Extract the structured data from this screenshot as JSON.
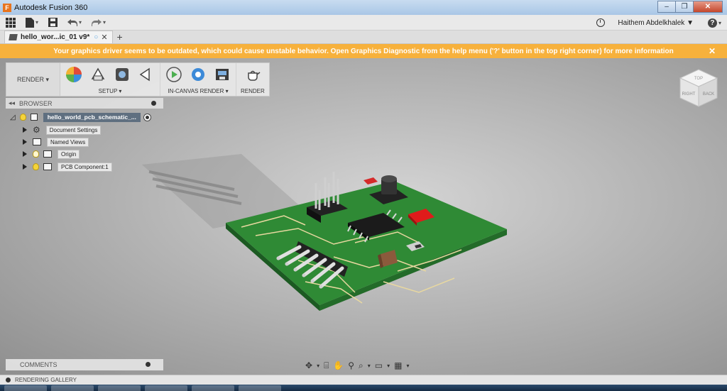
{
  "window": {
    "title": "Autodesk Fusion 360",
    "app_logo": "F",
    "controls": [
      "–",
      "❐",
      "✕"
    ]
  },
  "appbar": {
    "user": "Haithem Abdelkhalek ▼",
    "help": "?"
  },
  "tab": {
    "label": "hello_wor...ic_01 v9*",
    "close": "✕",
    "new": "+"
  },
  "banner": {
    "message": "Your graphics driver seems to be outdated, which could cause unstable behavior. Open Graphics Diagnostic from the help menu ('?' button in the top right corner) for more information",
    "close": "✕"
  },
  "toolbar": {
    "workspace": "RENDER ▾",
    "groups": [
      {
        "label": "SETUP ▾"
      },
      {
        "label": "IN-CANVAS RENDER ▾"
      },
      {
        "label": "RENDER"
      }
    ]
  },
  "browser": {
    "title": "BROWSER",
    "root": "hello_world_pcb_schematic_...",
    "items": [
      {
        "label": "Document Settings"
      },
      {
        "label": "Named Views"
      },
      {
        "label": "Origin"
      },
      {
        "label": "PCB Component:1"
      }
    ]
  },
  "viewcube": {
    "top": "TOP",
    "right": "RIGHT",
    "back": "BACK"
  },
  "comments": {
    "label": "COMMENTS"
  },
  "gallery": {
    "label": "RENDERING GALLERY"
  },
  "colors": {
    "banner": "#f7b13c",
    "pcb_green": "#2f8a35",
    "root_label": "#5f6f80"
  }
}
